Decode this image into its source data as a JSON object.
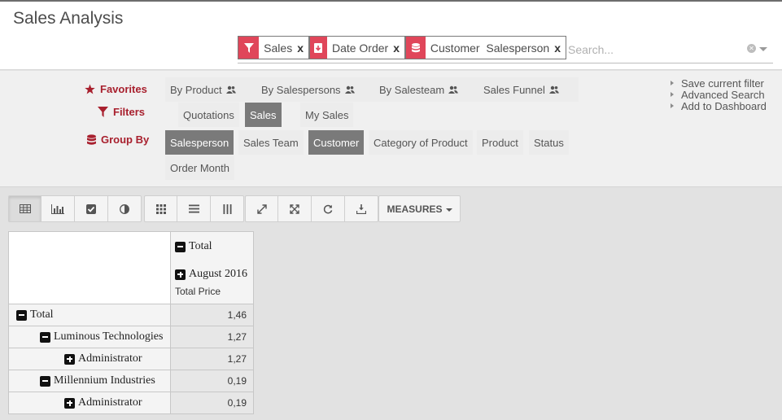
{
  "page": {
    "title": "Sales Analysis"
  },
  "search": {
    "facets": [
      {
        "icon": "filter-icon",
        "label": "Sales"
      },
      {
        "icon": "date-filter-icon",
        "label": "Date Order"
      },
      {
        "icon": "database-icon",
        "label": "Customer  Salesperson"
      }
    ],
    "remove_label": "x",
    "placeholder": "Search..."
  },
  "searchview": {
    "favorites": {
      "title": "Favorites",
      "items": [
        "By Product",
        "By Salespersons",
        "By Salesteam",
        "Sales Funnel"
      ]
    },
    "filters": {
      "title": "Filters",
      "items": [
        "Quotations",
        "Sales",
        "My Sales"
      ],
      "selected": "Sales"
    },
    "group_by": {
      "title": "Group By",
      "items": [
        "Salesperson",
        "Sales Team",
        "Customer",
        "Category of Product",
        "Product",
        "Status",
        "Order Month"
      ],
      "selected": [
        "Salesperson",
        "Customer"
      ]
    },
    "links": [
      "Save current filter",
      "Advanced Search",
      "Add to Dashboard"
    ]
  },
  "toolbar": {
    "view_icons": [
      "pivot-table-icon",
      "bar-chart-icon",
      "check-icon",
      "contrast-icon"
    ],
    "layout_icons": [
      "grid-icon",
      "list-icon",
      "columns-icon"
    ],
    "action_icons": [
      "expand-icon",
      "fullscreen-icon",
      "refresh-icon",
      "download-icon"
    ],
    "measures_label": "MEASURES"
  },
  "pivot": {
    "col_total": "Total",
    "col_group": "August 2016",
    "measure": "Total Price",
    "rows": [
      {
        "label": "Total",
        "toggle": "minus",
        "value": "1,46"
      },
      {
        "label": "Luminous Technologies",
        "toggle": "minus",
        "value": "1,27"
      },
      {
        "label": "Administrator",
        "toggle": "plus",
        "value": "1,27"
      },
      {
        "label": "Millennium Industries",
        "toggle": "minus",
        "value": "0,19"
      },
      {
        "label": "Administrator",
        "toggle": "plus",
        "value": "0,19"
      }
    ]
  },
  "colors": {
    "accent": "#e0465a",
    "group_title": "#a8202e",
    "selected_option": "#7a7a7a"
  }
}
